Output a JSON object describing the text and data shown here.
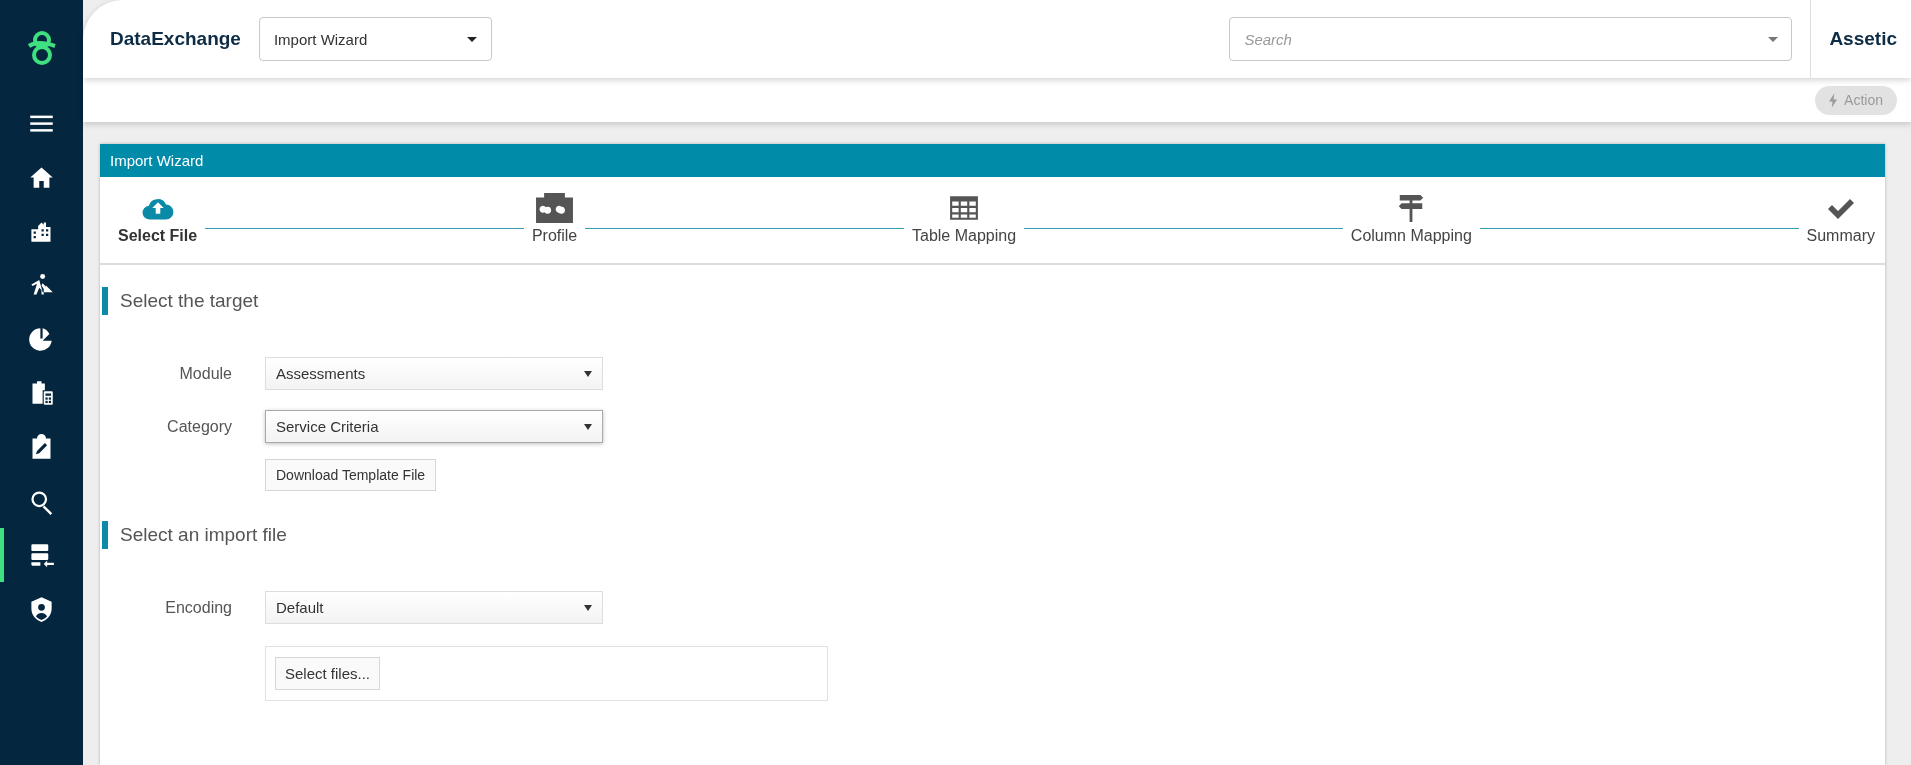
{
  "sidebar": {
    "items": [
      {
        "kind": "menu",
        "selected": false
      },
      {
        "kind": "home",
        "selected": false
      },
      {
        "kind": "buildings",
        "selected": false
      },
      {
        "kind": "worker",
        "selected": false
      },
      {
        "kind": "finance",
        "selected": false
      },
      {
        "kind": "calculator",
        "selected": false
      },
      {
        "kind": "edit",
        "selected": false
      },
      {
        "kind": "search",
        "selected": false
      },
      {
        "kind": "import",
        "selected": true
      },
      {
        "kind": "shield",
        "selected": false
      }
    ]
  },
  "header": {
    "app_title": "DataExchange",
    "page_select": {
      "value": "Import Wizard"
    },
    "search": {
      "placeholder": "Search"
    },
    "brand": "Assetic"
  },
  "action_bar": {
    "action_button": {
      "label": "Action",
      "disabled": true
    }
  },
  "wizard": {
    "title": "Import Wizard",
    "steps": [
      {
        "kind": "upload",
        "label": "Select File",
        "selected": true
      },
      {
        "kind": "profile",
        "label": "Profile",
        "selected": false
      },
      {
        "kind": "table",
        "label": "Table Mapping",
        "selected": false
      },
      {
        "kind": "signpost",
        "label": "Column Mapping",
        "selected": false
      },
      {
        "kind": "check",
        "label": "Summary",
        "selected": false
      }
    ],
    "sections": [
      {
        "title": "Select the target",
        "fields": [
          {
            "label": "Module",
            "value": "Assessments",
            "focused": false
          },
          {
            "label": "Category",
            "value": "Service Criteria",
            "focused": true
          }
        ],
        "button": "Download Template File"
      },
      {
        "title": "Select an import file",
        "fields": [
          {
            "label": "Encoding",
            "value": "Default",
            "focused": false
          }
        ],
        "file_button": "Select files..."
      }
    ]
  }
}
